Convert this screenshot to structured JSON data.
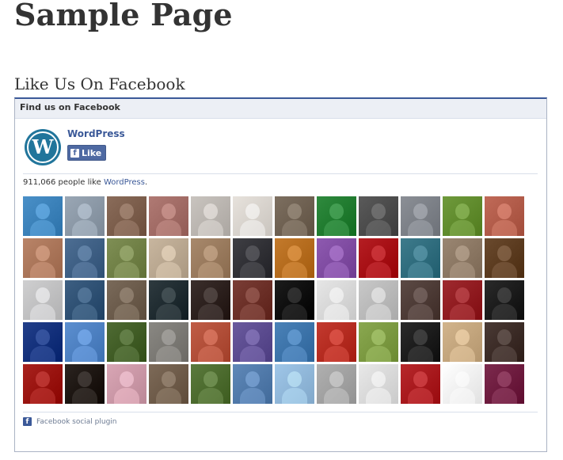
{
  "page": {
    "title": "Sample Page",
    "section_title": "Like Us On Facebook"
  },
  "fb_widget": {
    "header": "Find us on Facebook",
    "page_name": "WordPress",
    "like_label": "Like",
    "like_count_text": "911,066 people like ",
    "like_count_link": "WordPress",
    "like_count_suffix": ".",
    "footer": "Facebook social plugin",
    "colors": {
      "brand": "#3b5998",
      "header_bg": "#eceff5",
      "button_bg": "#4e69a2"
    }
  },
  "faces": {
    "icon": "profile-picture",
    "tones": [
      "#4a90c8",
      "#9aa7b5",
      "#8a6c5a",
      "#b07a74",
      "#c9c4bf",
      "#e7e2dc",
      "#7d6f60",
      "#2f8a3e",
      "#5a5a5a",
      "#8b8f96",
      "#6f9a3c",
      "#c06a58",
      "#b98468",
      "#4d6e93",
      "#7f8f55",
      "#c8b69f",
      "#a8896c",
      "#3f3f44",
      "#c37a2c",
      "#8e5ab0",
      "#b51e23",
      "#3e7b8c",
      "#9a8672",
      "#6a4a2e",
      "#cfcfd0",
      "#3d5f82",
      "#7a6a5a",
      "#2e3a3f",
      "#3b2f2c",
      "#7a3e36",
      "#1c1c1c",
      "#e6e6e6",
      "#c8c8c8",
      "#5c4a45",
      "#9f2a2f",
      "#2a2a2a",
      "#223f8a",
      "#5c8fd0",
      "#4f6b34",
      "#8a8883",
      "#c05d47",
      "#6a5a9e",
      "#4b82b8",
      "#c33a2f",
      "#8aa850",
      "#2b2b2b",
      "#d2b48c",
      "#4a3a35",
      "#a8221e",
      "#2b2420",
      "#d9a6b5",
      "#7d6a58",
      "#5b7a3d",
      "#5f88b8",
      "#9fc6e8",
      "#b0b0b0",
      "#e8e8e8",
      "#b7282c",
      "#ffffff",
      "#7c2a4d"
    ]
  }
}
